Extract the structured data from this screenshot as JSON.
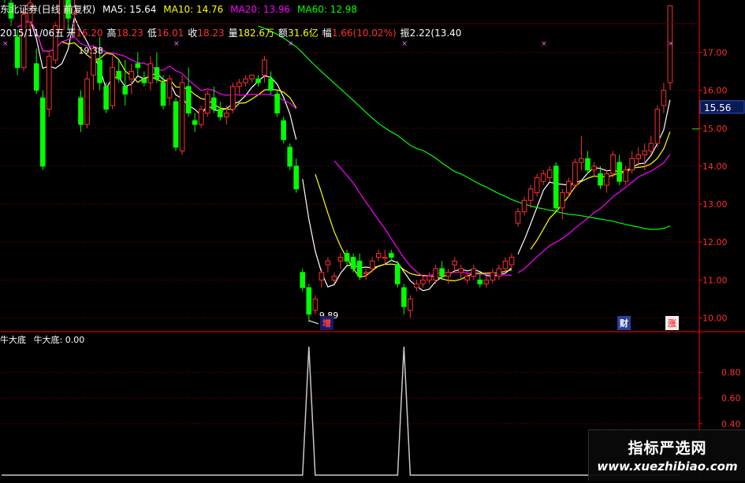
{
  "header": {
    "title": "东北证券(日线 前复权)",
    "ma": [
      {
        "label": "MA5: 15.64",
        "color": "#ffffff"
      },
      {
        "label": "MA10: 14.76",
        "color": "#ffff00"
      },
      {
        "label": "MA20: 13.96",
        "color": "#ff00ff"
      },
      {
        "label": "MA60: 12.98",
        "color": "#00ff00"
      }
    ]
  },
  "info_bar": {
    "date": {
      "text": "2015/11/06五",
      "color": "#ffffff"
    },
    "open": [
      {
        "text": "开",
        "color": "#ffffff"
      },
      {
        "text": "16.20",
        "color": "#ff3030"
      }
    ],
    "high": [
      {
        "text": "高",
        "color": "#ffffff"
      },
      {
        "text": "18.23",
        "color": "#ff3030"
      }
    ],
    "low": [
      {
        "text": "低",
        "color": "#ffffff"
      },
      {
        "text": "16.01",
        "color": "#ff3030"
      }
    ],
    "close": [
      {
        "text": "收",
        "color": "#ffffff"
      },
      {
        "text": "18.23",
        "color": "#ff3030"
      }
    ],
    "volume": [
      {
        "text": "量",
        "color": "#ffffff"
      },
      {
        "text": "182.6万",
        "color": "#ffff00"
      }
    ],
    "amount": [
      {
        "text": "额",
        "color": "#ffffff"
      },
      {
        "text": "31.6亿",
        "color": "#ffff00"
      }
    ],
    "change": [
      {
        "text": "幅",
        "color": "#ffffff"
      },
      {
        "text": "1.66(10.02%)",
        "color": "#ff3030"
      }
    ],
    "amplitude": [
      {
        "text": "振",
        "color": "#ffffff"
      },
      {
        "text": "2.22(13.40",
        "color": "#ffffff"
      }
    ]
  },
  "indicator_header": {
    "name": "牛大底",
    "label": "牛大底: 0.00"
  },
  "price_axis": {
    "ticks": [
      "17.00",
      "16.00",
      "15.00",
      "14.00",
      "13.00",
      "12.00",
      "11.00",
      "10.00"
    ],
    "current_price": "15.56"
  },
  "indicator_axis": {
    "ticks": [
      "0.80",
      "0.60",
      "0.40"
    ]
  },
  "annotations": {
    "high_label": "19.38",
    "low_label": "9.89",
    "marker_zeng": "增",
    "marker_cai": "财",
    "marker_zhang": "涨"
  },
  "colors": {
    "up": "#ff3030",
    "down": "#00ff00",
    "ma5": "#ffffff",
    "ma10": "#ffff00",
    "ma20": "#ff00ff",
    "ma60": "#00ff00",
    "grid": "#8b0000",
    "axis": "#ff0000",
    "indicator_line": "#c8c8c8"
  },
  "chart_data": [
    {
      "type": "candlestick",
      "title": "东北证券(日线 前复权)",
      "y_range": [
        9.7,
        17.3
      ],
      "x_count": 107,
      "ohlc": [
        [
          19.0,
          19.3,
          18.3,
          18.5
        ],
        [
          18.3,
          18.6,
          17.7,
          17.9
        ],
        [
          17.4,
          17.6,
          16.4,
          16.6
        ],
        [
          16.6,
          18.2,
          16.5,
          18.0
        ],
        [
          17.8,
          18.7,
          17.5,
          18.3
        ],
        [
          16.7,
          17.1,
          15.9,
          16.0
        ],
        [
          15.8,
          16.0,
          13.9,
          14.0
        ],
        [
          15.5,
          17.0,
          15.3,
          16.9
        ],
        [
          16.8,
          17.8,
          16.7,
          17.7
        ],
        [
          17.6,
          19.0,
          17.5,
          18.9
        ],
        [
          18.9,
          19.38,
          17.6,
          17.9
        ],
        [
          18.0,
          18.6,
          17.4,
          18.2
        ],
        [
          15.8,
          16.0,
          14.9,
          15.1
        ],
        [
          15.1,
          16.5,
          15.0,
          16.3
        ],
        [
          16.4,
          17.2,
          16.0,
          17.1
        ],
        [
          16.8,
          17.4,
          16.0,
          16.2
        ],
        [
          16.1,
          16.2,
          15.4,
          15.5
        ],
        [
          15.6,
          16.9,
          15.5,
          16.6
        ],
        [
          16.5,
          16.8,
          16.2,
          16.3
        ],
        [
          16.1,
          16.8,
          15.6,
          15.9
        ],
        [
          16.3,
          16.7,
          15.9,
          16.5
        ],
        [
          16.7,
          17.0,
          16.4,
          16.6
        ],
        [
          16.3,
          16.5,
          16.1,
          16.2
        ],
        [
          16.2,
          16.9,
          16.0,
          16.7
        ],
        [
          16.6,
          17.0,
          16.2,
          16.3
        ],
        [
          16.2,
          16.4,
          15.5,
          15.6
        ],
        [
          15.8,
          16.4,
          15.6,
          16.3
        ],
        [
          15.7,
          15.8,
          14.4,
          14.5
        ],
        [
          14.4,
          16.4,
          14.3,
          16.2
        ],
        [
          16.1,
          16.6,
          15.3,
          15.4
        ],
        [
          15.2,
          15.4,
          14.9,
          15.1
        ],
        [
          15.1,
          15.6,
          15.0,
          15.5
        ],
        [
          15.4,
          16.0,
          15.3,
          15.9
        ],
        [
          15.8,
          16.1,
          15.4,
          15.5
        ],
        [
          15.5,
          15.7,
          15.2,
          15.3
        ],
        [
          15.3,
          15.6,
          15.1,
          15.4
        ],
        [
          15.5,
          16.2,
          15.4,
          16.1
        ],
        [
          16.1,
          16.3,
          15.9,
          16.2
        ],
        [
          16.2,
          16.4,
          16.1,
          16.3
        ],
        [
          16.3,
          16.4,
          16.2,
          16.4
        ],
        [
          16.3,
          16.4,
          16.1,
          16.2
        ],
        [
          16.4,
          16.9,
          16.2,
          16.8
        ],
        [
          16.3,
          16.5,
          15.9,
          16.0
        ],
        [
          15.9,
          16.0,
          15.3,
          15.4
        ],
        [
          15.2,
          15.3,
          14.6,
          14.7
        ],
        [
          14.5,
          14.6,
          13.9,
          14.0
        ],
        [
          14.0,
          14.2,
          13.3,
          13.4
        ],
        [
          11.2,
          11.3,
          10.7,
          10.8
        ],
        [
          10.8,
          10.9,
          9.89,
          10.1
        ],
        [
          10.2,
          10.6,
          10.1,
          10.5
        ],
        [
          11.0,
          11.3,
          10.8,
          11.2
        ],
        [
          11.4,
          11.6,
          11.2,
          11.5
        ],
        [
          11.0,
          11.2,
          10.9,
          11.1
        ],
        [
          11.5,
          11.7,
          11.3,
          11.6
        ],
        [
          11.7,
          11.8,
          11.4,
          11.5
        ],
        [
          11.6,
          11.7,
          11.2,
          11.3
        ],
        [
          11.5,
          11.7,
          11.0,
          11.1
        ],
        [
          11.2,
          11.3,
          11.0,
          11.2
        ],
        [
          11.3,
          11.6,
          11.2,
          11.5
        ],
        [
          11.6,
          11.8,
          11.5,
          11.7
        ],
        [
          11.6,
          11.8,
          11.4,
          11.6
        ],
        [
          11.7,
          11.8,
          11.5,
          11.6
        ],
        [
          11.4,
          11.5,
          10.8,
          10.9
        ],
        [
          10.8,
          10.9,
          10.1,
          10.3
        ],
        [
          10.2,
          10.6,
          10.0,
          10.5
        ],
        [
          10.8,
          11.0,
          10.7,
          10.9
        ],
        [
          10.9,
          11.1,
          10.8,
          11.0
        ],
        [
          11.0,
          11.2,
          10.9,
          11.1
        ],
        [
          11.0,
          11.4,
          10.9,
          11.3
        ],
        [
          11.3,
          11.5,
          11.0,
          11.1
        ],
        [
          11.1,
          11.3,
          10.9,
          11.2
        ],
        [
          11.4,
          11.6,
          11.2,
          11.5
        ],
        [
          11.2,
          11.4,
          11.0,
          11.3
        ],
        [
          11.0,
          11.2,
          10.9,
          11.1
        ],
        [
          11.1,
          11.4,
          11.0,
          11.3
        ],
        [
          11.0,
          11.2,
          10.8,
          10.9
        ],
        [
          10.9,
          11.1,
          10.8,
          11.0
        ],
        [
          11.0,
          11.3,
          10.9,
          11.2
        ],
        [
          11.1,
          11.4,
          11.0,
          11.3
        ],
        [
          11.3,
          11.6,
          11.2,
          11.5
        ],
        [
          11.4,
          11.7,
          11.3,
          11.6
        ],
        [
          12.5,
          12.9,
          12.4,
          12.8
        ],
        [
          12.8,
          13.2,
          12.7,
          13.1
        ],
        [
          13.1,
          13.5,
          12.9,
          13.4
        ],
        [
          13.3,
          13.8,
          13.2,
          13.7
        ],
        [
          13.6,
          13.9,
          13.5,
          13.8
        ],
        [
          13.7,
          14.0,
          13.6,
          13.9
        ],
        [
          14.0,
          14.1,
          12.8,
          12.9
        ],
        [
          12.9,
          13.4,
          12.6,
          13.3
        ],
        [
          13.3,
          13.7,
          13.2,
          13.6
        ],
        [
          13.5,
          14.2,
          13.4,
          14.1
        ],
        [
          14.1,
          14.8,
          13.9,
          14.2
        ],
        [
          14.2,
          14.4,
          13.8,
          13.9
        ],
        [
          13.9,
          14.1,
          13.7,
          14.0
        ],
        [
          13.8,
          14.0,
          13.4,
          13.5
        ],
        [
          13.5,
          13.9,
          13.3,
          13.8
        ],
        [
          13.8,
          14.4,
          13.7,
          14.3
        ],
        [
          14.1,
          14.3,
          13.5,
          13.6
        ],
        [
          13.6,
          14.0,
          13.5,
          13.9
        ],
        [
          13.9,
          14.4,
          13.8,
          14.2
        ],
        [
          14.2,
          14.5,
          14.0,
          14.3
        ],
        [
          14.3,
          14.6,
          13.9,
          14.4
        ],
        [
          14.4,
          14.8,
          14.3,
          14.6
        ],
        [
          14.6,
          15.6,
          14.5,
          15.5
        ],
        [
          15.6,
          16.2,
          15.4,
          16.0
        ],
        [
          16.2,
          18.23,
          16.01,
          18.23
        ]
      ],
      "ma5_x_range": [
        [
          2,
          46
        ],
        [
          47,
          80
        ],
        [
          81,
          106
        ]
      ],
      "ma60_x_range": [
        40,
        106
      ],
      "indicator": {
        "name": "牛大底",
        "y_range": [
          0,
          1
        ],
        "spikes_at": [
          48,
          63
        ],
        "value": 0.0
      }
    }
  ]
}
